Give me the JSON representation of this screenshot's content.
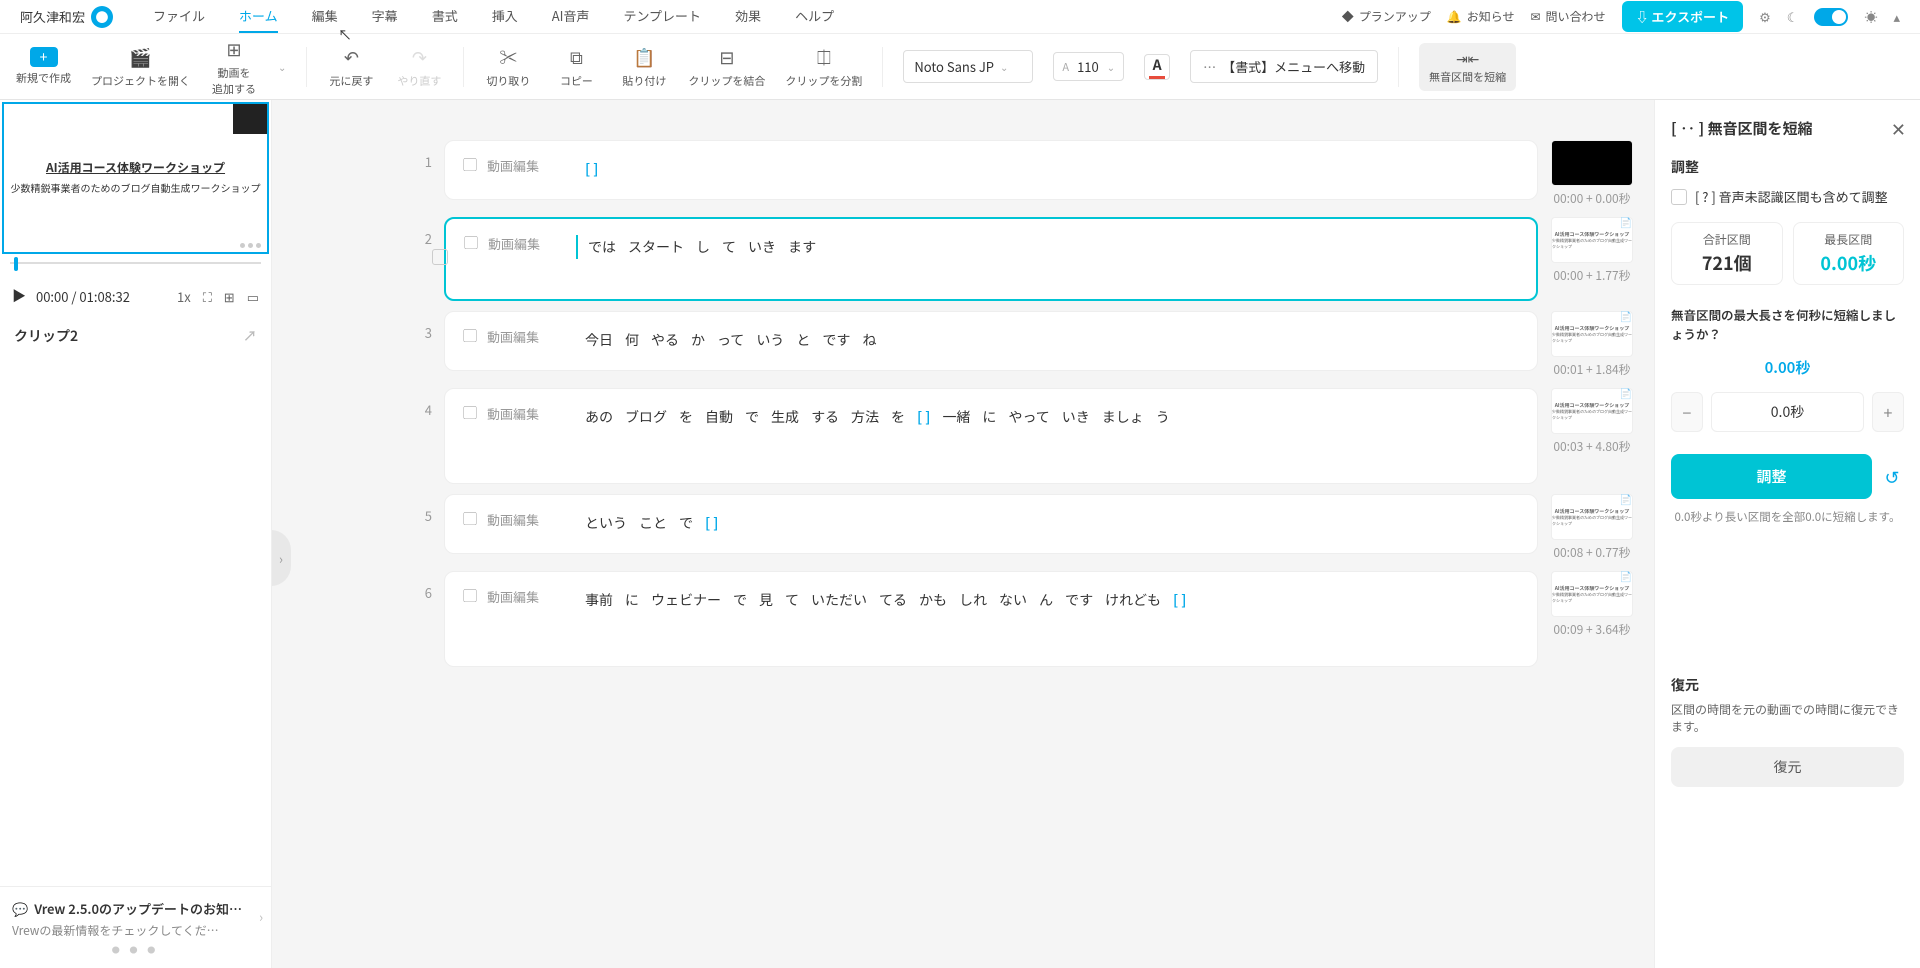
{
  "user": {
    "name": "阿久津和宏"
  },
  "menu": {
    "file": "ファイル",
    "home": "ホーム",
    "edit": "編集",
    "subtitle": "字幕",
    "format": "書式",
    "insert": "挿入",
    "ai_voice": "AI音声",
    "template": "テンプレート",
    "effect": "効果",
    "help": "ヘルプ"
  },
  "topright": {
    "plan_up": "プランアップ",
    "notice": "お知らせ",
    "contact": "問い合わせ",
    "export": "エクスポート"
  },
  "toolbar": {
    "new": "新規で作成",
    "open_project": "プロジェクトを開く",
    "add_video": "動画を\n追加する",
    "undo": "元に戻す",
    "redo": "やり直す",
    "cut": "切り取り",
    "copy": "コピー",
    "paste": "貼り付け",
    "merge": "クリップを結合",
    "split": "クリップを分割",
    "font": "Noto Sans JP",
    "font_size": "110",
    "format_menu": "【書式】メニューへ移動",
    "silence": "無音区間を短縮"
  },
  "preview": {
    "title": "AI活用コース体験ワークショップ",
    "subtitle": "少数精鋭事業者のためのブログ自動生成ワークショップ"
  },
  "playback": {
    "current": "00:00",
    "total": "01:08:32",
    "speed": "1x"
  },
  "clip_name": "クリップ2",
  "clips": [
    {
      "num": "1",
      "label": "動画編集",
      "words": [
        "[ ]"
      ],
      "time": "00:00 + 0.00秒",
      "thumb_black": true
    },
    {
      "num": "2",
      "label": "動画編集",
      "words": [
        "では",
        "スタート",
        "し",
        "て",
        "いき",
        "ます"
      ],
      "time": "00:00 + 1.77秒",
      "selected": true
    },
    {
      "num": "3",
      "label": "動画編集",
      "words": [
        "今日",
        "何",
        "やる",
        "か",
        "って",
        "いう",
        "と",
        "です",
        "ね"
      ],
      "time": "00:01 + 1.84秒"
    },
    {
      "num": "4",
      "label": "動画編集",
      "words": [
        "あの",
        "ブログ",
        "を",
        "自動",
        "で",
        "生成",
        "する",
        "方法",
        "を",
        "[ ]",
        "一緒",
        "に",
        "やって",
        "いき",
        "ましょ",
        "う"
      ],
      "time": "00:03 + 4.80秒",
      "tall": true
    },
    {
      "num": "5",
      "label": "動画編集",
      "words": [
        "という",
        "こと",
        "で",
        "[ ]"
      ],
      "time": "00:08 + 0.77秒"
    },
    {
      "num": "6",
      "label": "動画編集",
      "words": [
        "事前",
        "に",
        "ウェビナー",
        "で",
        "見",
        "て",
        "いただい",
        "てる",
        "かも",
        "しれ",
        "ない",
        "ん",
        "です",
        "けれども",
        "[ ]"
      ],
      "time": "00:09 + 3.64秒",
      "tall": true
    }
  ],
  "news": {
    "line1": "Vrew 2.5.0のアップデートのお知…",
    "line2": "Vrewの最新情報をチェックしてくだ…"
  },
  "panel": {
    "title": "[ ‥ ] 無音区間を短縮",
    "adjust_header": "調整",
    "include_unrecognized": "[ ? ] 音声未認識区間も含めて調整",
    "total_label": "合計区間",
    "total_value": "721個",
    "max_label": "最長区間",
    "max_value": "0.00秒",
    "question": "無音区間の最大長さを何秒に短縮しましょうか？",
    "display_value": "0.00秒",
    "input_value": "0.0秒",
    "adjust_btn": "調整",
    "note": "0.0秒より長い区間を全部0.0に短縮します。",
    "restore_title": "復元",
    "restore_desc": "区間の時間を元の動画での時間に復元できます。",
    "restore_btn": "復元"
  }
}
